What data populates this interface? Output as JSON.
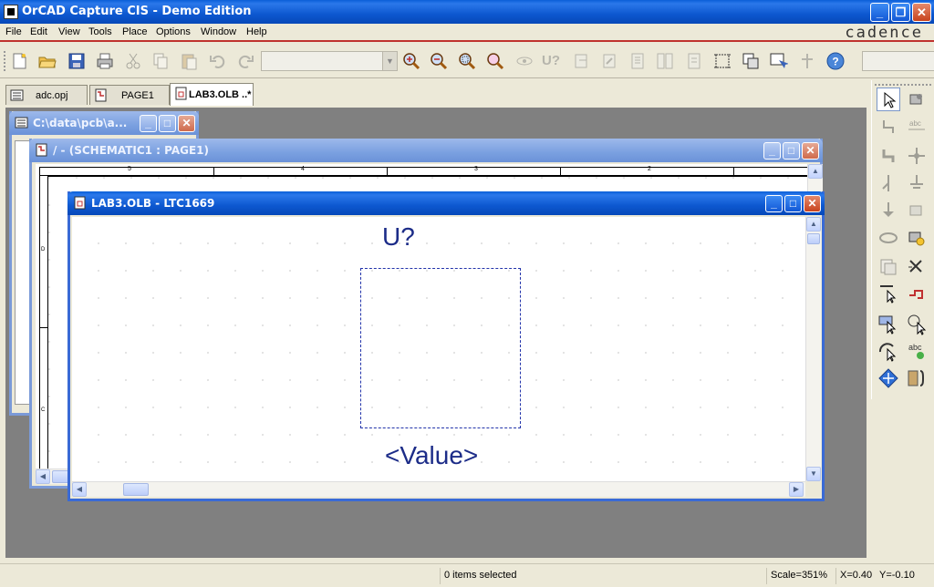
{
  "app": {
    "title": "OrCAD Capture CIS - Demo Edition",
    "brand": "cadence"
  },
  "menu": [
    "File",
    "Edit",
    "View",
    "Tools",
    "Place",
    "Options",
    "Window",
    "Help"
  ],
  "toolbar": {
    "buttons": [
      "new-icon",
      "open-icon",
      "save-icon",
      "print-icon",
      "cut-icon",
      "copy-icon",
      "paste-icon",
      "undo-icon",
      "redo-icon",
      "zoom-in-icon",
      "zoom-out-icon",
      "zoom-area-icon",
      "zoom-all-icon",
      "eye-icon",
      "annotate-icon",
      "back-annotate-icon",
      "update-icon",
      "netlist-icon",
      "cross-ref-icon",
      "bom-icon",
      "drc-icon",
      "snap-grid-icon",
      "area-select-icon",
      "drag-icon",
      "project-manager-icon",
      "help-icon"
    ],
    "annotate_label": "U?"
  },
  "tabs": [
    {
      "label": "adc.opj",
      "active": false
    },
    {
      "label": "PAGE1",
      "active": false
    },
    {
      "label": "LAB3.OLB ..*",
      "active": true
    }
  ],
  "windows": {
    "project": {
      "title": "C:\\data\\pcb\\a..."
    },
    "schematic": {
      "title": "/ - (SCHEMATIC1 : PAGE1)",
      "ruler": [
        "5",
        "4",
        "3",
        "2"
      ],
      "row_labels": [
        "D",
        "C"
      ]
    },
    "part": {
      "title": "LAB3.OLB - LTC1669",
      "ref": "U?",
      "value": "<Value>"
    }
  },
  "palette": [
    "select-icon",
    "ieee-symbol-icon",
    "pin-icon",
    "pin-array-icon",
    "line-icon",
    "polyline-icon",
    "rectangle-icon",
    "ellipse-icon",
    "arc-icon",
    "elliptical-arc-icon",
    "bezier-icon",
    "text-icon",
    "part-icon",
    "no-connect-icon"
  ],
  "status": {
    "selection": "0 items selected",
    "scale": "Scale=351%",
    "x": "X=0.40",
    "y": "Y=-0.10"
  },
  "colors": {
    "title_active": "#0d58d0",
    "accent_red": "#c0332e",
    "schematic_text": "#1c2c88"
  }
}
